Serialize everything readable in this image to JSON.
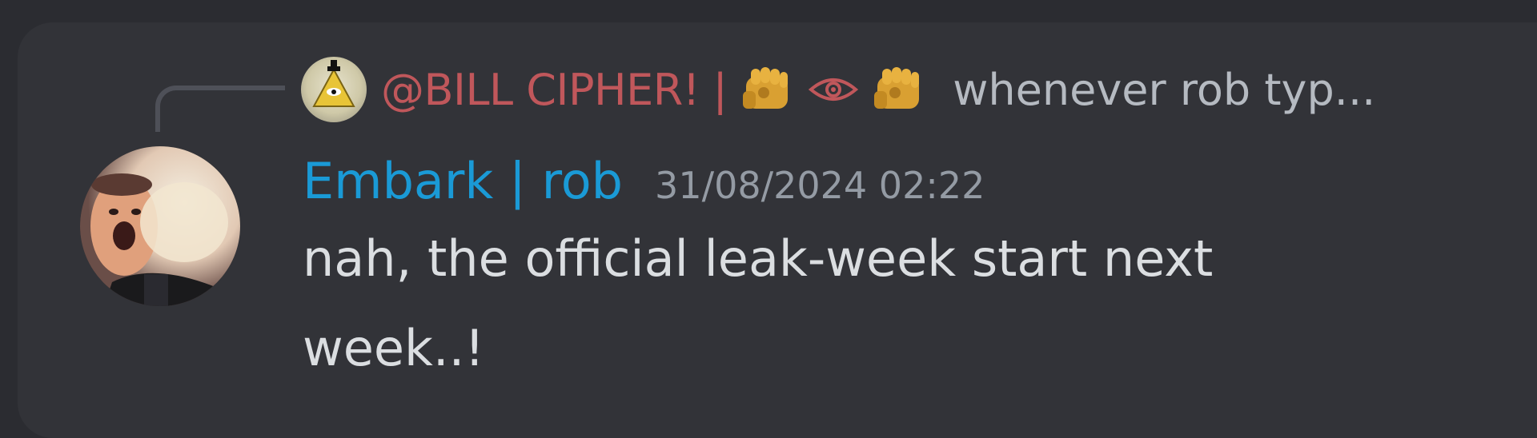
{
  "reply": {
    "author": "@BILL CIPHER! | ",
    "emojis": [
      "fist-icon",
      "eye-icon",
      "fist-icon"
    ],
    "preview_text": "whenever rob typ..."
  },
  "message": {
    "author": "Embark | rob",
    "timestamp": "31/08/2024 02:22",
    "content": "nah, the official leak-week start next week..!"
  },
  "colors": {
    "background": "#2b2c31",
    "card": "#323338",
    "reply_author": "#c0575b",
    "author": "#1a9ad6",
    "timestamp": "#949ba4",
    "text": "#dbdee1",
    "muted_text": "#b5bac1"
  }
}
